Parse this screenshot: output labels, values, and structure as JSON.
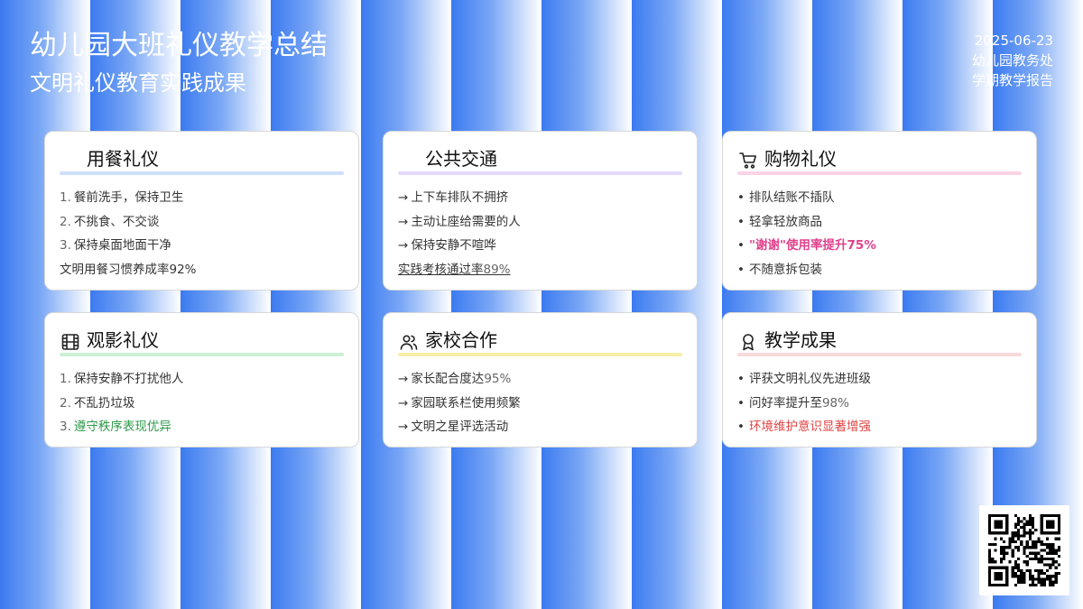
{
  "header": {
    "title": "幼儿园大班礼仪教学总结",
    "subtitle": "文明礼仪教育实践成果",
    "date": "2025-06-23",
    "department": "幼儿园教务处",
    "report_type": "学期教学报告"
  },
  "cards": [
    {
      "title": "用餐礼仪",
      "icon": "none",
      "accent": "#cfe0fb",
      "items": [
        "餐前洗手，保持卫生",
        "不挑食、不交谈",
        "保持桌面地面干净"
      ],
      "highlight_prefix": "文明用餐习惯养成率",
      "highlight_value": "92%",
      "highlight_color": "#2f63c4"
    },
    {
      "title": "公共交通",
      "icon": "none",
      "accent": "#e4d9fb",
      "items": [
        "上下车排队不拥挤",
        "主动让座给需要的人",
        "保持安静不喧哗"
      ],
      "highlight_prefix": "实践考核通过率",
      "highlight_value": "89%"
    },
    {
      "title": "购物礼仪",
      "icon": "shopping-cart-icon",
      "accent": "#fbd3e4",
      "items": [
        "排队结账不插队",
        "轻拿轻放商品",
        "不随意拆包装"
      ],
      "highlight": "\"谢谢\"使用率提升75%",
      "highlight_color": "#e0418c"
    },
    {
      "title": "观影礼仪",
      "icon": "film-icon",
      "accent": "#cdf1d6",
      "items": [
        "保持安静不打扰他人",
        "不乱扔垃圾"
      ],
      "highlight": "遵守秩序表现优异",
      "highlight_color": "#2f9a4c"
    },
    {
      "title": "家校合作",
      "icon": "users-icon",
      "accent": "#f8efa7",
      "items_prefix": [
        "家长配合度达",
        "家园联系栏使用频繁",
        "文明之星评选活动"
      ],
      "items_value": [
        "95%",
        "",
        ""
      ]
    },
    {
      "title": "教学成果",
      "icon": "award-icon",
      "accent": "#f8d9da",
      "items_prefix": [
        "评获文明礼仪先进班级",
        "问好率提升至"
      ],
      "items_value": [
        "",
        "98%"
      ],
      "highlight": "环境维护意识显著增强",
      "highlight_color": "#e04444"
    }
  ],
  "colors": {
    "stripe_dark": "#3b7af0",
    "stripe_light": "#ffffff"
  }
}
